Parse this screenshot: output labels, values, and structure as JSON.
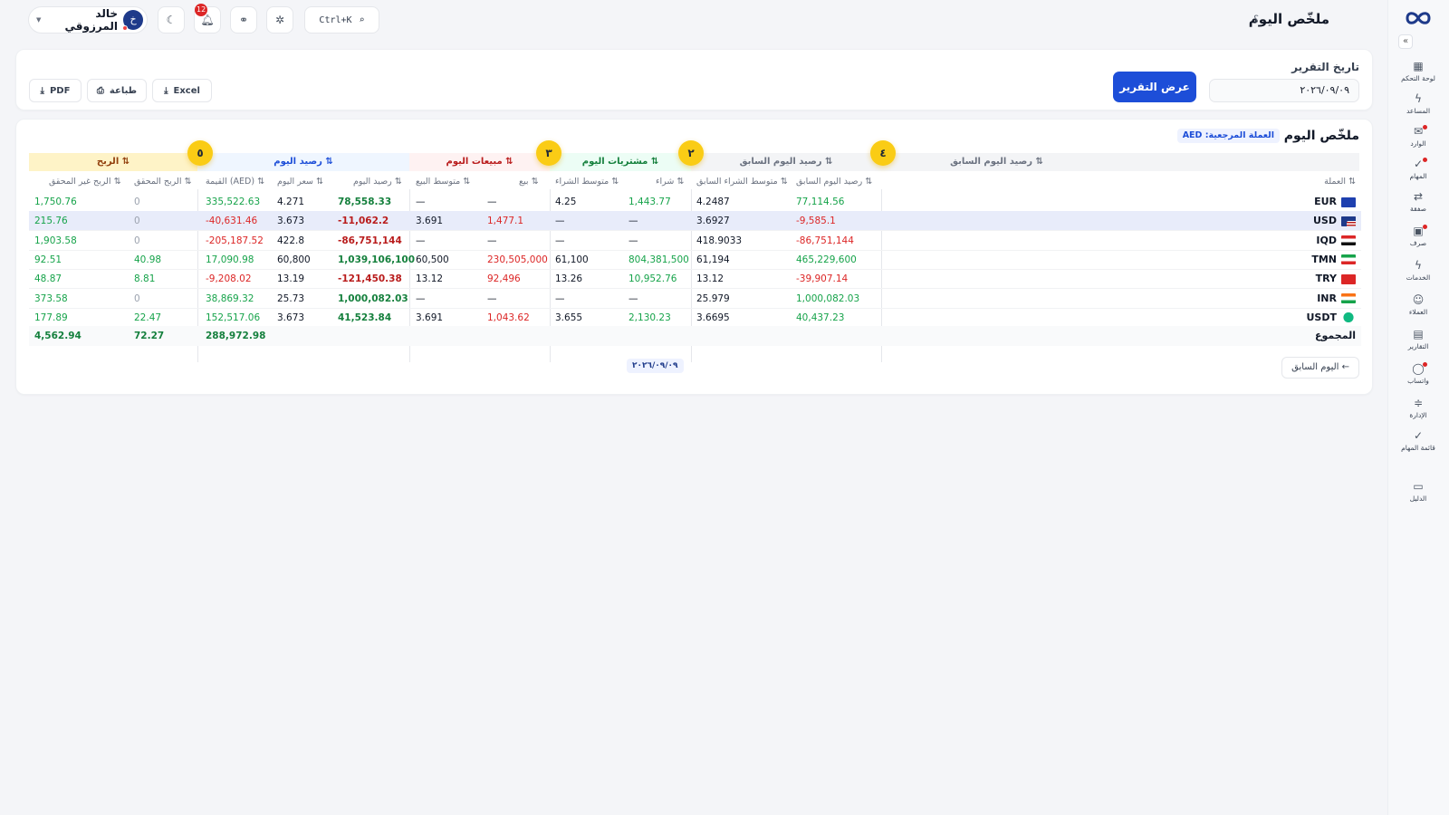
{
  "header": {
    "title": "ملخّص اليوم",
    "help": "؟",
    "user_name": "خالد المرزوقي",
    "avatar_letter": "خ",
    "notif_count": "12",
    "search_shortcut": "Ctrl+K"
  },
  "sidebar": {
    "items": [
      {
        "label": "لوحة التحكم",
        "icon": "▦"
      },
      {
        "label": "المساعد",
        "icon": "ϟ"
      },
      {
        "label": "الوارد",
        "icon": "✉"
      },
      {
        "label": "المهام",
        "icon": "✓"
      },
      {
        "label": "صفقة",
        "icon": "⇄"
      },
      {
        "label": "صرف",
        "icon": "▣"
      },
      {
        "label": "الخدمات",
        "icon": "ϟ"
      },
      {
        "label": "العملاء",
        "icon": "☺"
      },
      {
        "label": "التقارير",
        "icon": "▤"
      },
      {
        "label": "واتساب",
        "icon": "◯"
      },
      {
        "label": "الإدارة",
        "icon": "≑"
      },
      {
        "label": "قائمة المهام",
        "icon": "✓"
      },
      {
        "label": "الدليل",
        "icon": "▭"
      }
    ]
  },
  "report": {
    "date_label": "تاريخ التقرير",
    "date_value": "٢٠٢٦/٠٩/٠٩",
    "show_button": "عرض التقرير",
    "excel": "Excel",
    "print": "طباعة",
    "pdf": "PDF"
  },
  "summary": {
    "title": "ملخّص اليوم",
    "ref_currency": "العملة المرجعية: AED",
    "prev_day": "← اليوم السابق",
    "date_chip": "٢٠٢٦/٠٩/٠٩",
    "markers": [
      "٤",
      "٢",
      "٣",
      "٥"
    ],
    "groups": {
      "prev": "رصيد اليوم السابق ⇅",
      "buy": "مشتريات اليوم ⇅",
      "sell": "مبيعات اليوم ⇅",
      "bal": "رصيد اليوم ⇅",
      "profit": "الربح ⇅"
    },
    "columns": {
      "currency": "العملة ⇅",
      "prev_bal": "رصيد اليوم السابق ⇅",
      "prev_avg": "متوسط الشراء السابق ⇅",
      "buy": "شراء ⇅",
      "buy_avg": "متوسط الشراء ⇅",
      "sell": "بيع ⇅",
      "sell_avg": "متوسط البيع ⇅",
      "today_bal": "رصيد اليوم ⇅",
      "today_rate": "سعر اليوم ⇅",
      "value": "القيمة (AED) ⇅",
      "realized": "الربح المحقق ⇅",
      "unrealized": "الربح غير المحقق ⇅"
    },
    "rows": [
      {
        "code": "EUR",
        "prev_bal": "77,114.56",
        "prev_avg": "4.2487",
        "buy": "1,443.77",
        "buy_avg": "4.25",
        "sell": "—",
        "sell_avg": "—",
        "today_bal": "78,558.33",
        "today_rate": "4.271",
        "value": "335,522.63",
        "realized": "0",
        "unrealized": "1,750.76"
      },
      {
        "code": "USD",
        "prev_bal": "-9,585.1",
        "prev_avg": "3.6927",
        "buy": "—",
        "buy_avg": "—",
        "sell": "1,477.1",
        "sell_avg": "3.691",
        "today_bal": "-11,062.2",
        "today_rate": "3.673",
        "value": "-40,631.46",
        "realized": "0",
        "unrealized": "215.76"
      },
      {
        "code": "IQD",
        "prev_bal": "-86,751,144",
        "prev_avg": "418.9033",
        "buy": "—",
        "buy_avg": "—",
        "sell": "—",
        "sell_avg": "—",
        "today_bal": "-86,751,144",
        "today_rate": "422.8",
        "value": "-205,187.52",
        "realized": "0",
        "unrealized": "1,903.58"
      },
      {
        "code": "TMN",
        "prev_bal": "465,229,600",
        "prev_avg": "61,194",
        "buy": "804,381,500",
        "buy_avg": "61,100",
        "sell": "230,505,000",
        "sell_avg": "60,500",
        "today_bal": "1,039,106,100",
        "today_rate": "60,800",
        "value": "17,090.98",
        "realized": "40.98",
        "unrealized": "92.51"
      },
      {
        "code": "TRY",
        "prev_bal": "-39,907.14",
        "prev_avg": "13.12",
        "buy": "10,952.76",
        "buy_avg": "13.26",
        "sell": "92,496",
        "sell_avg": "13.12",
        "today_bal": "-121,450.38",
        "today_rate": "13.19",
        "value": "-9,208.02",
        "realized": "8.81",
        "unrealized": "48.87"
      },
      {
        "code": "INR",
        "prev_bal": "1,000,082.03",
        "prev_avg": "25.979",
        "buy": "—",
        "buy_avg": "—",
        "sell": "—",
        "sell_avg": "—",
        "today_bal": "1,000,082.03",
        "today_rate": "25.73",
        "value": "38,869.32",
        "realized": "0",
        "unrealized": "373.58"
      },
      {
        "code": "USDT",
        "prev_bal": "40,437.23",
        "prev_avg": "3.6695",
        "buy": "2,130.23",
        "buy_avg": "3.655",
        "sell": "1,043.62",
        "sell_avg": "3.691",
        "today_bal": "41,523.84",
        "today_rate": "3.673",
        "value": "152,517.06",
        "realized": "22.47",
        "unrealized": "177.89"
      }
    ],
    "total": {
      "label": "المجموع",
      "value": "288,972.98",
      "realized": "72.27",
      "unrealized": "4,562.94"
    }
  },
  "colors": {
    "accent": "#1d4ed8",
    "positive": "#16a34a",
    "negative": "#dc2626",
    "marker": "#facc15"
  }
}
